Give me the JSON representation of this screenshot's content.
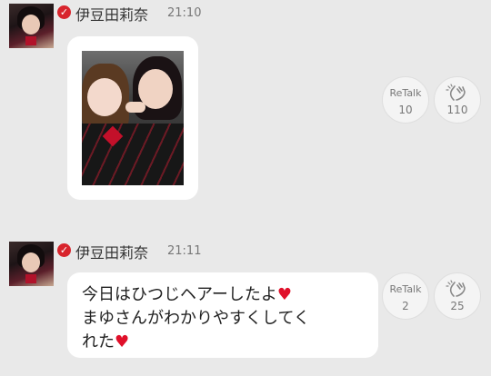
{
  "messages": [
    {
      "user_name": "伊豆田莉奈",
      "time": "21:10",
      "type": "photo",
      "retalk_label": "ReTalk",
      "retalk_count": "10",
      "clap_count": "110"
    },
    {
      "user_name": "伊豆田莉奈",
      "time": "21:11",
      "type": "text",
      "text_lines": [
        "今日はひつじヘアーしたよ",
        "まゆさんがわかりやすくしてく",
        "れた"
      ],
      "heart": "♥",
      "retalk_label": "ReTalk",
      "retalk_count": "2",
      "clap_count": "25"
    }
  ],
  "icons": {
    "verified": "check-badge-icon",
    "clap": "clap-hands-icon"
  },
  "colors": {
    "background": "#e9e9e9",
    "bubble": "#ffffff",
    "verified_badge": "#d8242c",
    "heart": "#e0102a"
  }
}
